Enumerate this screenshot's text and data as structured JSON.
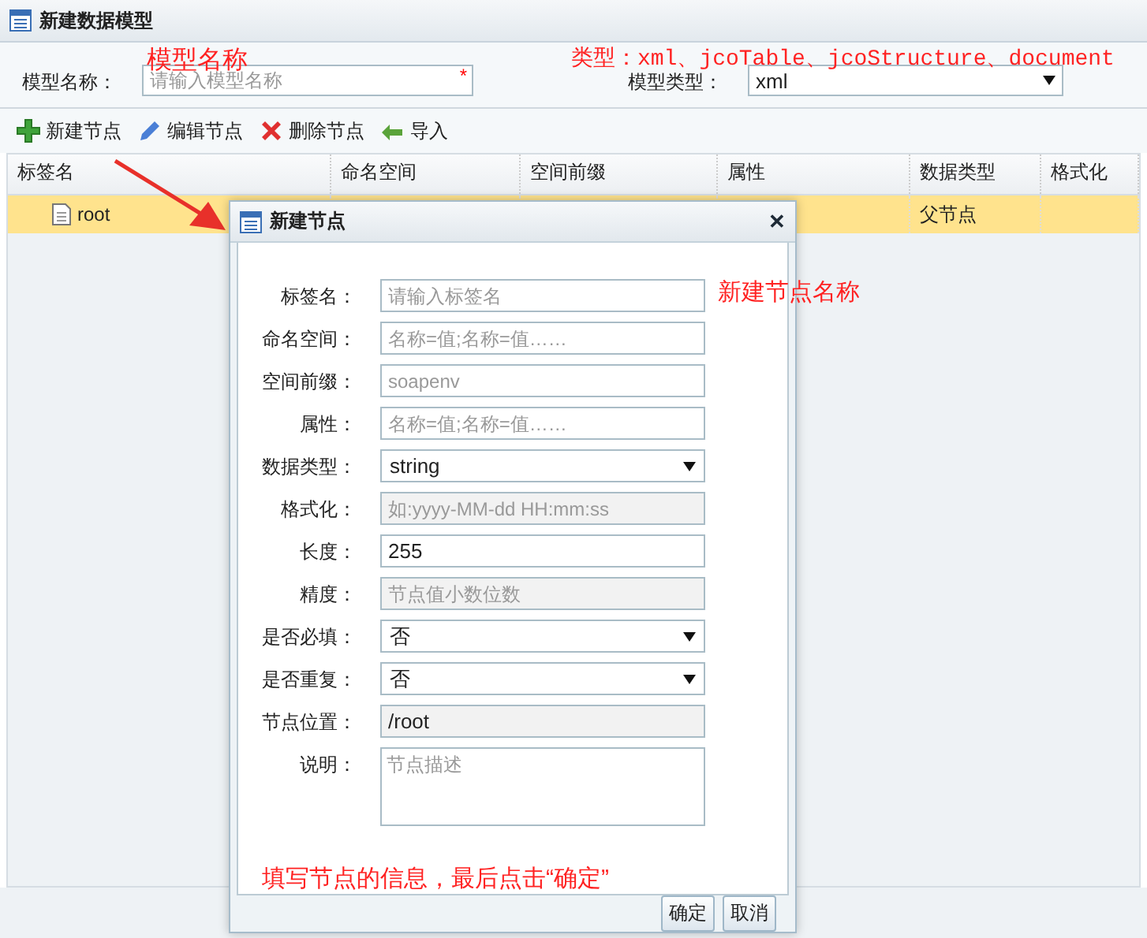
{
  "window": {
    "title": "新建数据模型"
  },
  "form": {
    "name_label": "模型名称：",
    "name_placeholder": "请输入模型名称",
    "required_mark": "*",
    "type_label": "模型类型：",
    "type_value": "xml"
  },
  "toolbar": [
    {
      "label": "新建节点",
      "kind": "add"
    },
    {
      "label": "编辑节点",
      "kind": "edit"
    },
    {
      "label": "删除节点",
      "kind": "delete"
    },
    {
      "label": "导入",
      "kind": "import"
    }
  ],
  "table": {
    "columns": [
      "标签名",
      "命名空间",
      "空间前缀",
      "属性",
      "数据类型",
      "格式化"
    ],
    "rows": [
      {
        "label": "root",
        "data_type": "父节点",
        "selected": true
      }
    ]
  },
  "dialog": {
    "title": "新建节点",
    "close": "✕",
    "fields": [
      {
        "label": "标签名：",
        "kind": "input",
        "placeholder": "请输入标签名",
        "disabled": false
      },
      {
        "label": "命名空间：",
        "kind": "input",
        "placeholder": "名称=值;名称=值……",
        "disabled": false
      },
      {
        "label": "空间前缀：",
        "kind": "input",
        "placeholder": "soapenv",
        "disabled": false
      },
      {
        "label": "属性：",
        "kind": "input",
        "placeholder": "名称=值;名称=值……",
        "disabled": false
      },
      {
        "label": "数据类型：",
        "kind": "select",
        "value": "string",
        "disabled": false
      },
      {
        "label": "格式化：",
        "kind": "input",
        "placeholder": "如:yyyy-MM-dd HH:mm:ss",
        "disabled": true
      },
      {
        "label": "长度：",
        "kind": "input",
        "value": "255",
        "disabled": false
      },
      {
        "label": "精度：",
        "kind": "input",
        "placeholder": "节点值小数位数",
        "disabled": true
      },
      {
        "label": "是否必填：",
        "kind": "select",
        "value": "否",
        "disabled": false
      },
      {
        "label": "是否重复：",
        "kind": "select",
        "value": "否",
        "disabled": false
      },
      {
        "label": "节点位置：",
        "kind": "input",
        "value": "/root",
        "disabled": true
      },
      {
        "label": "说明：",
        "kind": "textarea",
        "placeholder": "节点描述",
        "disabled": false
      }
    ],
    "buttons": [
      "确定",
      "取消"
    ]
  },
  "annotations": [
    "模型名称",
    "类型：xml、jcoTable、jcoStructure、document",
    "新建节点名称",
    "填写节点的信息，最后点击“确定”"
  ]
}
